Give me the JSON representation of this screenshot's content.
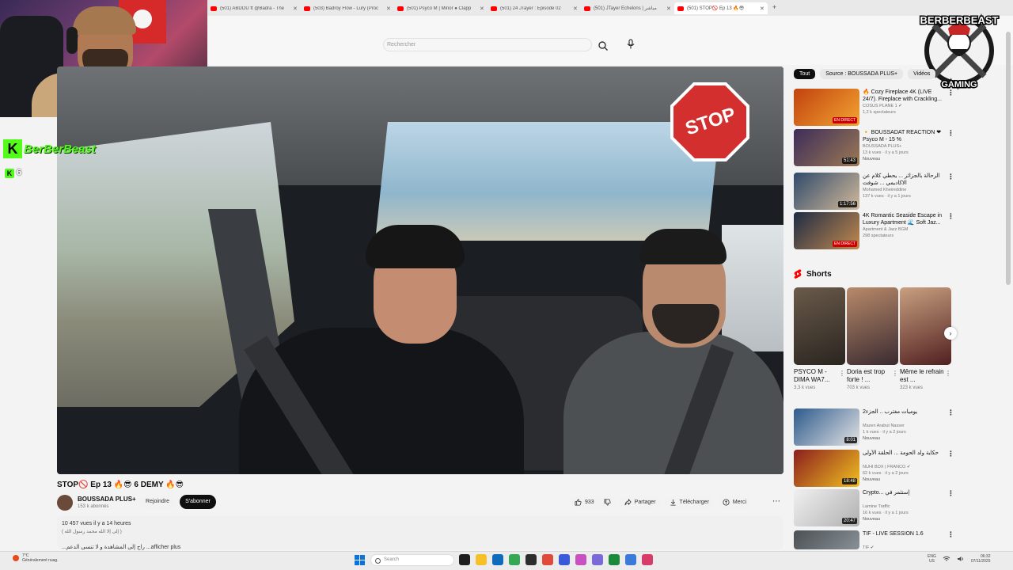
{
  "browser": {
    "tabs": [
      {
        "label": "(501) ABDOU ft @Badra - The",
        "active": false
      },
      {
        "label": "(503) Badroy Flow - Lury (Proc",
        "active": false
      },
      {
        "label": "(501) Psyco M | Minor ● Clapp",
        "active": false
      },
      {
        "label": "(501) 24 JTayer : Episode 02",
        "active": false
      },
      {
        "label": "(501) JTayer Echelons | مباشر",
        "active": false
      },
      {
        "label": "(501) STOP🚫 Ep 13 🔥😎",
        "active": true
      }
    ],
    "new_tab_symbol": "+"
  },
  "header": {
    "search_placeholder": "Rechercher"
  },
  "overlay": {
    "brand_top": "BERBERBEAST",
    "brand_bottom": "GAMING",
    "kick_letter": "K",
    "kick_name": "BerBerBeast",
    "kick_count": "6"
  },
  "video": {
    "stop_sign_text": "STOP",
    "title": "STOP🚫 Ep 13 🔥😎 6 DEMY 🔥😎",
    "channel_name": "BOUSSADA PLUS+",
    "channel_subs": "153 k abonnés",
    "join_label": "Rejoindre",
    "subscribe_label": "S'abonner",
    "likes": "933",
    "share_label": "Partager",
    "download_label": "Télécharger",
    "thanks_label": "Merci",
    "more_symbol": "⋯",
    "description_views": "10 457 vues  il y a 14 heures",
    "description_line": "( إلى إلا الله محمد رسول الله )",
    "description_more": "...راج إلى المشاهدة و لا تنسى الدعم ...afficher plus"
  },
  "sidebar": {
    "chips": [
      {
        "label": "Tout",
        "active": true
      },
      {
        "label": "Source : BOUSSADA PLUS+",
        "active": false
      },
      {
        "label": "Vidéos",
        "active": false
      }
    ],
    "recommendations": [
      {
        "title": "🔥 Cozy Fireplace 4K (LIVE 24/7). Fireplace with Crackling...",
        "channel": "COSUS PLANE 1 ✔",
        "meta": "1,2 k spectateurs",
        "badge": "EN DIRECT",
        "badge_type": "live",
        "new": "",
        "color_a": "#c2420f",
        "color_b": "#f2a431"
      },
      {
        "title": "🔸 BOUSSADAT REACTION ❤ Psyco M - 15 %",
        "channel": "BOUSSADA PLUS+",
        "meta": "13 k vues · il y a 5 jours",
        "badge": "51:43",
        "badge_type": "dur",
        "new": "Nouveau",
        "color_a": "#3d2c5a",
        "color_b": "#9b7a54"
      },
      {
        "title": "الرحالة بالجزائر ... يحطي كلام عن الاكاديمي ... شوفت",
        "channel": "Mohamed Kheireddine",
        "meta": "137 k vues · il y a 1 jours",
        "badge": "1:17:56",
        "badge_type": "dur",
        "new": "",
        "color_a": "#2f4a6a",
        "color_b": "#d3b99a"
      },
      {
        "title": "4K Romantic Seaside Escape in Luxury Apartment 🌊 Soft Jaz...",
        "channel": "Apartment & Jazz BGM",
        "meta": "298 spectateurs",
        "badge": "EN DIRECT",
        "badge_type": "live",
        "new": "",
        "color_a": "#1e2b44",
        "color_b": "#c28a4f"
      },
      {
        "title": "يوميات مغترب .. الجزء2",
        "channel": "Mazen Arabut Nasser",
        "meta": "1 k vues · il y a 2 jours",
        "badge": "8:01",
        "badge_type": "dur",
        "new": "Nouveau",
        "color_a": "#2d5a8c",
        "color_b": "#e4e4e4"
      },
      {
        "title": "حكاية ولد الحومة ... الحلقة الأولى",
        "channel": "NUHI BOX | FRANCO ✔",
        "meta": "62 k vues · il y a 2 jours",
        "badge": "18:48",
        "badge_type": "dur",
        "new": "Nouveau",
        "color_a": "#8c1e1e",
        "color_b": "#f0c020"
      },
      {
        "title": "Crypto... إستثمر في",
        "channel": "Lamine Traffic",
        "meta": "16 k vues · il y a 1 jours",
        "badge": "20:47",
        "badge_type": "dur",
        "new": "Nouveau",
        "color_a": "#f0f0f0",
        "color_b": "#b0b0b0"
      },
      {
        "title": "TIF - LIVE SESSION 1.6",
        "channel": "TIF ✔",
        "meta": "",
        "badge": "",
        "badge_type": "",
        "new": "",
        "color_a": "#4a5054",
        "color_b": "#8a9196"
      }
    ],
    "shorts_title": "Shorts",
    "shorts": [
      {
        "title": "PSYCO M - DIMA WA7...",
        "views": "3,3 k vues",
        "color_a": "#6a5a4a",
        "color_b": "#2a2520"
      },
      {
        "title": "Doria est trop forte ! ...",
        "views": "703 k vues",
        "color_a": "#b88a6a",
        "color_b": "#3a2a30"
      },
      {
        "title": "Même le refrain est ...",
        "views": "323 k vues",
        "color_a": "#c9a080",
        "color_b": "#502020"
      }
    ],
    "next_symbol": "›"
  },
  "taskbar": {
    "weather_line1": "7°C",
    "weather_line2": "Généralement nuag.",
    "search_placeholder": "Search",
    "lang_line1": "ENG",
    "lang_line2": "US",
    "time": "06:32",
    "date": "07/11/2025",
    "app_colors": [
      "#1e1e1e",
      "#f6c026",
      "#0f6cbd",
      "#34a853",
      "#2d2d2d",
      "#e04a3a",
      "#3a5bd9",
      "#c850c0",
      "#7a6ad8",
      "#1a8a3a",
      "#3a7ad8",
      "#d83a6a"
    ]
  }
}
